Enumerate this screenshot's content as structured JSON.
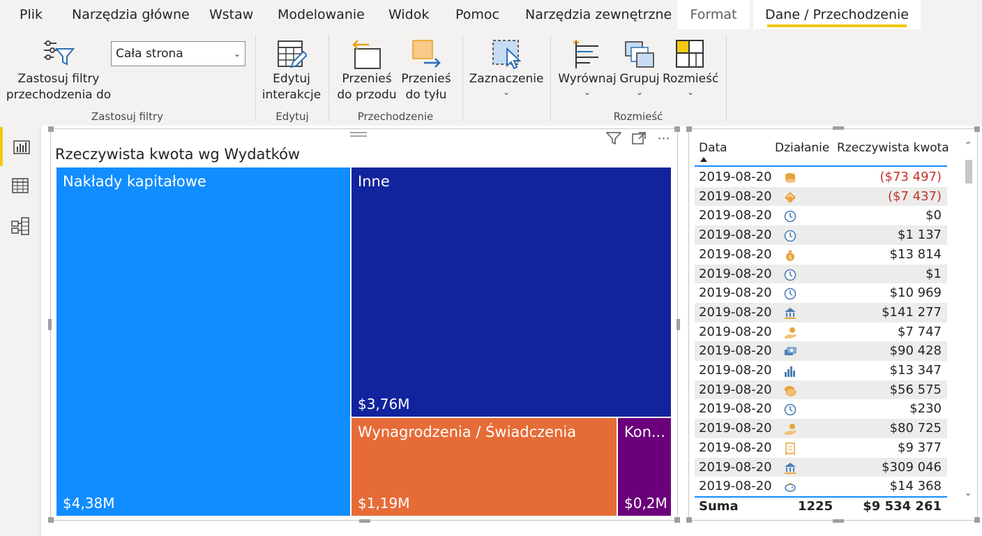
{
  "menu": {
    "items": [
      "Plik",
      "Narzędzia główne",
      "Wstaw",
      "Modelowanie",
      "Widok",
      "Pomoc",
      "Narzędzia zewnętrzne",
      "Format",
      "Dane / Przechodzenie"
    ]
  },
  "ribbon": {
    "apply_filters_line1": "Zastosuj filtry",
    "apply_filters_line2": "przechodzenia do",
    "dropdown_value": "Cała strona",
    "group_apply": "Zastosuj filtry",
    "edit_line1": "Edytuj",
    "edit_line2": "interakcje",
    "group_edit": "Edytuj",
    "forward_line1": "Przenieś",
    "forward_line2": "do przodu",
    "back_line1": "Przenieś",
    "back_line2": "do tyłu",
    "group_drill": "Przechodzenie",
    "selection": "Zaznaczenie",
    "align": "Wyrównaj",
    "group_btn": "Grupuj",
    "arrange": "Rozmieść",
    "group_arrange": "Rozmieść"
  },
  "treemap": {
    "title": "Rzeczywista kwota wg Wydatków",
    "tiles": [
      {
        "name": "Nakłady kapitałowe",
        "value": "$4,38M",
        "color": "#118dff"
      },
      {
        "name": "Inne",
        "value": "$3,76M",
        "color": "#12239e"
      },
      {
        "name": "Wynagrodzenia / Świadczenia",
        "value": "$1,19M",
        "color": "#e66c37"
      },
      {
        "name": "Kon...",
        "value": "$0,2M",
        "color": "#6b007b"
      }
    ]
  },
  "table": {
    "headers": [
      "Data",
      "Działanie",
      "Rzeczywista kwota"
    ],
    "rows": [
      {
        "date": "2019-08-20",
        "icon": "coin-stack",
        "amount": "($73 497)",
        "neg": true
      },
      {
        "date": "2019-08-20",
        "icon": "gem",
        "amount": "($7 437)",
        "neg": true
      },
      {
        "date": "2019-08-20",
        "icon": "clock",
        "amount": "$0",
        "neg": false
      },
      {
        "date": "2019-08-20",
        "icon": "clock",
        "amount": "$1 137",
        "neg": false
      },
      {
        "date": "2019-08-20",
        "icon": "money-bag",
        "amount": "$13 814",
        "neg": false
      },
      {
        "date": "2019-08-20",
        "icon": "clock",
        "amount": "$1",
        "neg": false
      },
      {
        "date": "2019-08-20",
        "icon": "clock",
        "amount": "$10 969",
        "neg": false
      },
      {
        "date": "2019-08-20",
        "icon": "bank",
        "amount": "$141 277",
        "neg": false
      },
      {
        "date": "2019-08-20",
        "icon": "hand-coin",
        "amount": "$7 747",
        "neg": false
      },
      {
        "date": "2019-08-20",
        "icon": "cash",
        "amount": "$90 428",
        "neg": false
      },
      {
        "date": "2019-08-20",
        "icon": "bar-chart",
        "amount": "$13 347",
        "neg": false
      },
      {
        "date": "2019-08-20",
        "icon": "coins",
        "amount": "$56 575",
        "neg": false
      },
      {
        "date": "2019-08-20",
        "icon": "clock",
        "amount": "$230",
        "neg": false
      },
      {
        "date": "2019-08-20",
        "icon": "hand-coin",
        "amount": "$80 725",
        "neg": false
      },
      {
        "date": "2019-08-20",
        "icon": "receipt",
        "amount": "$9 377",
        "neg": false
      },
      {
        "date": "2019-08-20",
        "icon": "bank",
        "amount": "$309 046",
        "neg": false
      },
      {
        "date": "2019-08-20",
        "icon": "piggy-bank",
        "amount": "$14 368",
        "neg": false
      }
    ],
    "footer": {
      "label": "Suma",
      "count": "1225",
      "total": "$9 534 261"
    }
  },
  "colors": {
    "accent": "#f2c811",
    "table_line": "#118dff",
    "negative": "#c4312c"
  }
}
